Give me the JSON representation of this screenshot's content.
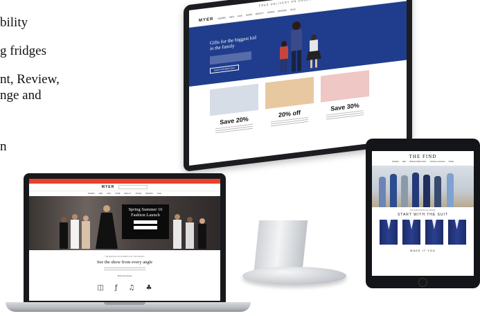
{
  "left_text": {
    "line1": "bility",
    "line2": "g fridges",
    "line3": "nt, Review,",
    "line4": "nge and",
    "line5": "n"
  },
  "monitor": {
    "topbar": "FREE DELIVERY ON ORDERS OVER $100",
    "logo": "MYER",
    "nav": [
      "WOMEN",
      "MEN",
      "KIDS",
      "HOME",
      "BEAUTY",
      "SHOES",
      "BRANDS",
      "SALE"
    ],
    "hero_title": "Gifts for the biggest kid in the family",
    "hero_button": "SHOP FATHER'S DAY",
    "cards": [
      {
        "title": "Save 20%",
        "img_color": "#d7dde6"
      },
      {
        "title": "20% off",
        "img_color": "#e8c8a0"
      },
      {
        "title": "Save 30%",
        "img_color": "#efc7c4"
      }
    ]
  },
  "laptop": {
    "logo": "MYER",
    "nav": [
      "WOMEN",
      "MEN",
      "KIDS",
      "HOME",
      "BEAUTY",
      "SHOES",
      "BRANDS",
      "SALE"
    ],
    "hero_title": "Spring Summer 16 Fashion Launch",
    "section_kicker": "THE MARVELLOUS MOMENTS OF THE RUNWAY",
    "section_title": "See the show from every angle",
    "section_sub": "#MyerSpring16",
    "social_icons": [
      "instagram-icon",
      "facebook-icon",
      "twitter-icon",
      "snapchat-icon"
    ]
  },
  "tablet": {
    "title": "THE FIND",
    "nav": [
      "WOMEN",
      "MEN",
      "BRAND DIRECTORY",
      "SHOES & ACCESS",
      "HOME"
    ],
    "caption": "The perfect look for any occasion",
    "section_title": "START WITH THE SUIT",
    "footer_title": "MAKE IT YOU"
  },
  "colors": {
    "monitor_hero": "#1f3d8c",
    "laptop_bar": "#e9412c",
    "device_frame": "#1b1d21"
  }
}
